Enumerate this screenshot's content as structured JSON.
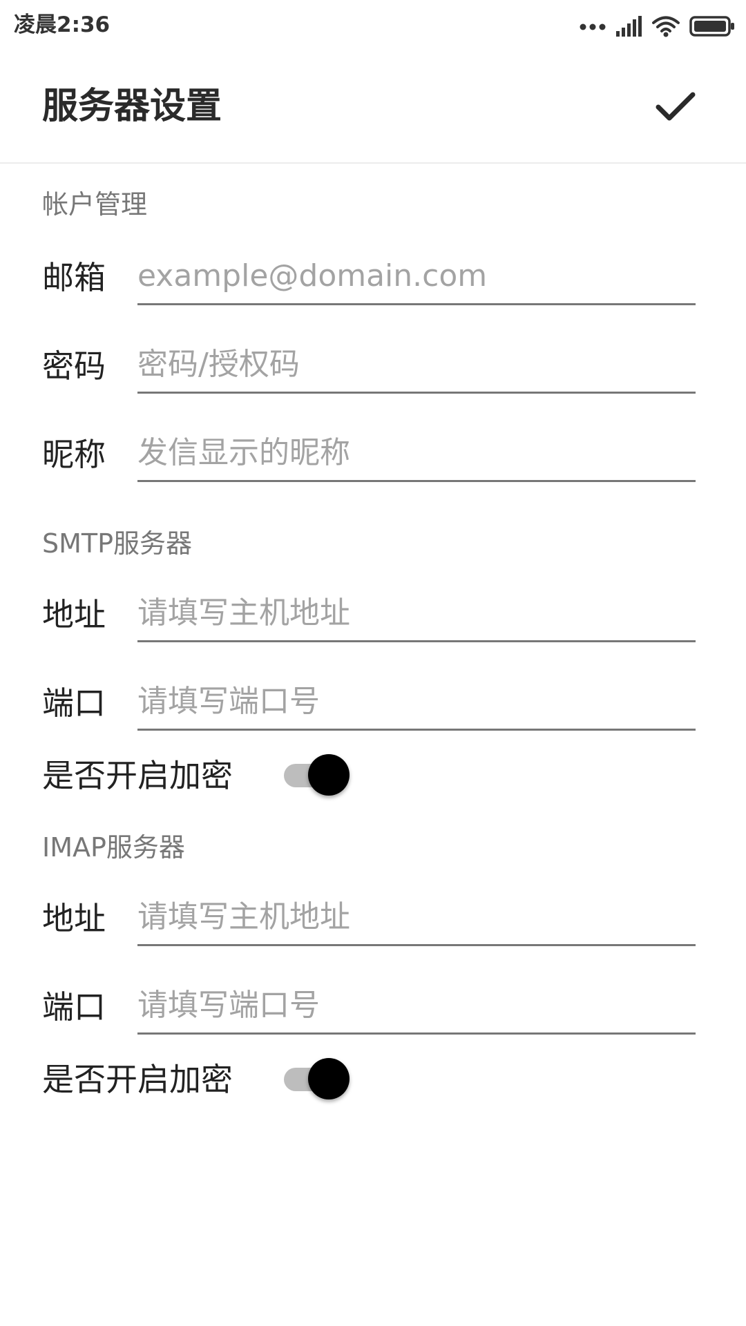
{
  "status_bar": {
    "time": "凌晨2:36",
    "icons": [
      "more-dots-icon",
      "signal-icon",
      "wifi-icon",
      "battery-icon"
    ]
  },
  "app_bar": {
    "title": "服务器设置",
    "confirm_icon": "check-icon"
  },
  "account": {
    "header": "帐户管理",
    "email": {
      "label": "邮箱",
      "value": "",
      "placeholder": "example@domain.com"
    },
    "password": {
      "label": "密码",
      "value": "",
      "placeholder": "密码/授权码"
    },
    "nickname": {
      "label": "昵称",
      "value": "",
      "placeholder": "发信显示的昵称"
    }
  },
  "smtp": {
    "header": "SMTP服务器",
    "address": {
      "label": "地址",
      "value": "",
      "placeholder": "请填写主机地址"
    },
    "port": {
      "label": "端口",
      "value": "",
      "placeholder": "请填写端口号"
    },
    "encryption": {
      "label": "是否开启加密",
      "enabled": true
    }
  },
  "imap": {
    "header": "IMAP服务器",
    "address": {
      "label": "地址",
      "value": "",
      "placeholder": "请填写主机地址"
    },
    "port": {
      "label": "端口",
      "value": "",
      "placeholder": "请填写端口号"
    },
    "encryption": {
      "label": "是否开启加密",
      "enabled": true
    }
  },
  "colors": {
    "background": "#ffffff",
    "text_primary": "#222222",
    "text_secondary": "#777777",
    "placeholder": "#a3a3a3",
    "underline": "#777777",
    "toggle_track": "#bdbdbd",
    "toggle_knob": "#000000"
  }
}
